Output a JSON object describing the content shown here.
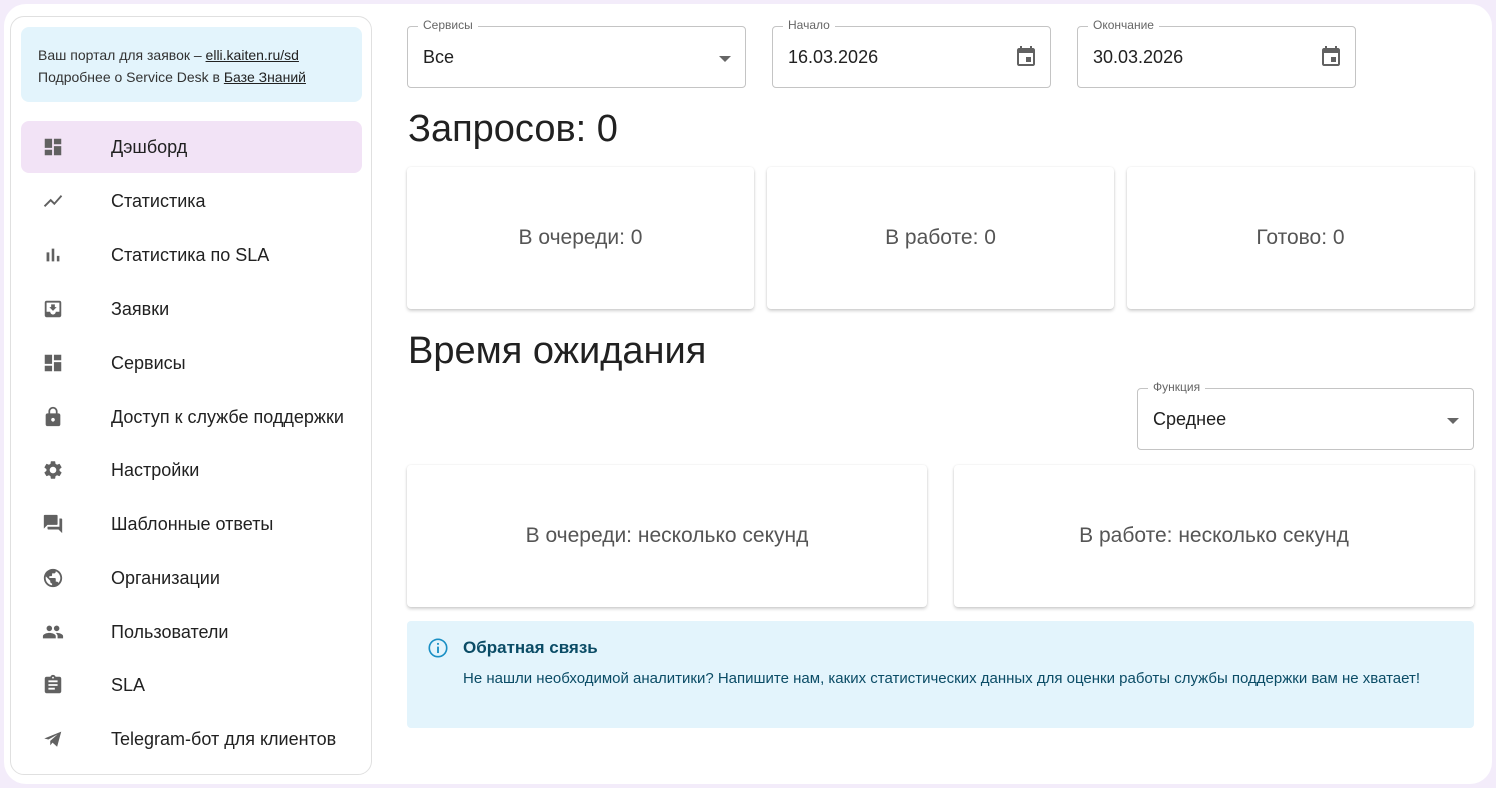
{
  "portal": {
    "line1_prefix": "Ваш портал для заявок – ",
    "line1_link": "elli.kaiten.ru/sd",
    "line2_prefix": "Подробнее о Service Desk в ",
    "line2_link": "Базе Знаний"
  },
  "sidebar": {
    "items": [
      {
        "label": "Дэшборд",
        "icon": "dashboard-icon",
        "active": true
      },
      {
        "label": "Статистика",
        "icon": "trending-icon"
      },
      {
        "label": "Статистика по SLA",
        "icon": "bar-chart-icon"
      },
      {
        "label": "Заявки",
        "icon": "inbox-icon"
      },
      {
        "label": "Сервисы",
        "icon": "dashboard-icon"
      },
      {
        "label": "Доступ к службе поддержки",
        "icon": "lock-icon"
      },
      {
        "label": "Настройки",
        "icon": "gear-icon"
      },
      {
        "label": "Шаблонные ответы",
        "icon": "chat-icon"
      },
      {
        "label": "Организации",
        "icon": "globe-icon"
      },
      {
        "label": "Пользователи",
        "icon": "people-icon"
      },
      {
        "label": "SLA",
        "icon": "clipboard-icon"
      },
      {
        "label": "Telegram-бот для клиентов",
        "icon": "send-icon"
      }
    ]
  },
  "filters": {
    "services": {
      "label": "Сервисы",
      "value": "Все"
    },
    "start": {
      "label": "Начало",
      "value": "16.03.2026"
    },
    "end": {
      "label": "Окончание",
      "value": "30.03.2026"
    }
  },
  "requests": {
    "title": "Запросов: 0",
    "cards": [
      "В очереди: 0",
      "В работе: 0",
      "Готово: 0"
    ]
  },
  "waiting": {
    "title": "Время ожидания",
    "function": {
      "label": "Функция",
      "value": "Среднее"
    },
    "cards": [
      "В очереди: несколько секунд",
      "В работе: несколько секунд"
    ]
  },
  "feedback": {
    "title": "Обратная связь",
    "text": "Не нашли необходимой аналитики? Напишите нам, каких статистических данных для оценки работы службы поддержки вам не хватает!"
  },
  "colors": {
    "active_nav": "#f2e3f6",
    "info_bg": "#e3f4fc",
    "info_text": "#0b4c66",
    "info_icon": "#1a8fc4"
  }
}
